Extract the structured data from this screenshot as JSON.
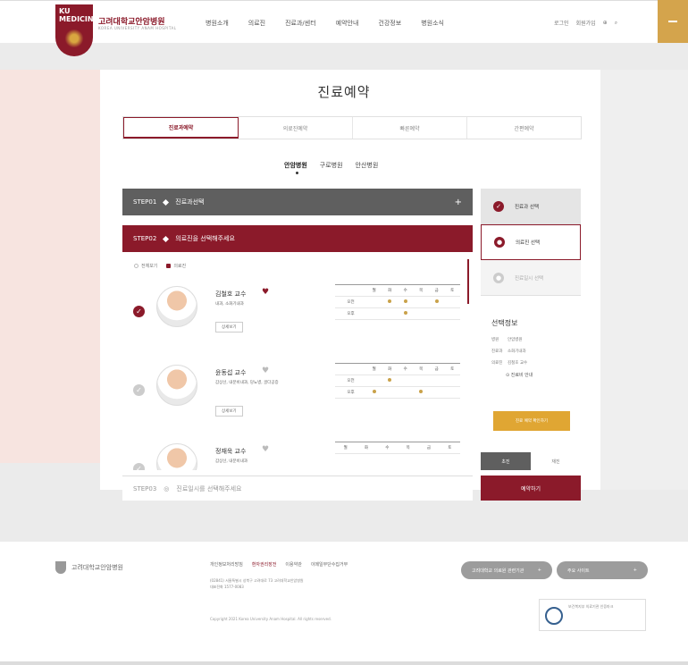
{
  "header": {
    "logo_text": "KU MEDICINE",
    "hospital_name": "고려대학교안암병원",
    "hospital_sub": "KOREA UNIVERSITY ANAM HOSPITAL",
    "nav": [
      "병원소개",
      "의료진",
      "진료과/센터",
      "예약안내",
      "건강정보",
      "병원소식"
    ],
    "util": [
      "로그인",
      "회원가입",
      "EN",
      "KR"
    ]
  },
  "title": "진료예약",
  "tabs": [
    "진료과예약",
    "의료진예약",
    "빠른예약",
    "간편예약"
  ],
  "subtabs": [
    "안암병원",
    "구로병원",
    "안산병원"
  ],
  "steps": {
    "step1_label": "STEP01",
    "step1_title": "진료과선택",
    "step1_icon": "+",
    "step2_label": "STEP02",
    "step2_title": "의료진을 선택해주세요",
    "step3_label": "STEP03",
    "step3_title": "진료일시를 선택해주세요"
  },
  "radio": [
    "전체보기",
    "의료진"
  ],
  "doctors": [
    {
      "name": "김철호 교수",
      "spec": "내과, 소화기내과",
      "btn": "상세보기",
      "checked": true
    },
    {
      "name": "윤동섭 교수",
      "spec": "갑상선, 내분비내과, 당뇨병, 골다공증",
      "btn": "상세보기",
      "checked": false
    },
    {
      "name": "정재욱 교수",
      "spec": "갑상선, 내분비내과",
      "btn": "상세보기",
      "checked": false
    }
  ],
  "schedule_days": [
    "월",
    "화",
    "수",
    "목",
    "금",
    "토"
  ],
  "schedule_rows": [
    "오전",
    "오후"
  ],
  "right_panel": {
    "step1": "진료과 선택",
    "step2": "의료진 선택",
    "step3": "진료일시 선택",
    "summary_title": "선택정보",
    "rows": [
      {
        "k": "병원",
        "v": "안암병원"
      },
      {
        "k": "진료과",
        "v": "소화기내과"
      },
      {
        "k": "의료진",
        "v": "김철호 교수"
      }
    ],
    "link": "진료비 안내",
    "gold_button": "진료 예약 확인하기",
    "tab_on": "초진",
    "tab_off": "재진",
    "submit": "예약하기"
  },
  "footer": {
    "logo": "고려대학교안암병원",
    "links": [
      "개인정보처리방침",
      "환자권리장전",
      "이용약관",
      "이메일무단수집거부"
    ],
    "addr1": "(02841) 서울특별시 성북구 고려대로 73 고려대학교안암병원",
    "addr2": "대표전화 1577-0083",
    "copy": "Copyright 2021 Korea University Anam Hospital. All rights reserved.",
    "select1": "고려대학교 의료원 관련기관",
    "select2": "주요 사이트",
    "cert": "보건복지부 의료기관 인증마크"
  }
}
